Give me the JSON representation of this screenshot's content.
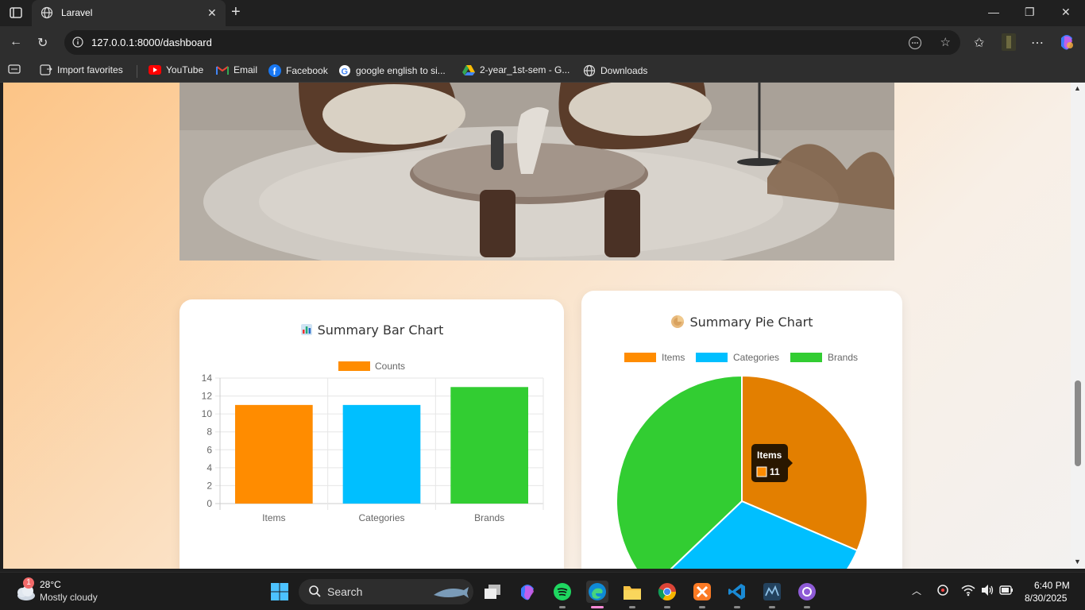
{
  "browser": {
    "tab_title": "Laravel",
    "url": "127.0.0.1:8000/dashboard"
  },
  "favorites": [
    {
      "label": "Import favorites",
      "icon": "import-icon"
    },
    {
      "label": "YouTube",
      "icon": "youtube-icon"
    },
    {
      "label": "Email",
      "icon": "gmail-icon"
    },
    {
      "label": "Facebook",
      "icon": "facebook-icon"
    },
    {
      "label": "google english to si...",
      "icon": "google-icon"
    },
    {
      "label": "2-year_1st-sem - G...",
      "icon": "google-drive-icon"
    },
    {
      "label": "Downloads",
      "icon": "globe-icon"
    }
  ],
  "page": {
    "bar_card_title": "Summary Bar Chart",
    "pie_card_title": "Summary Pie Chart"
  },
  "colors": {
    "items": "#ff8c00",
    "categories": "#00bfff",
    "brands": "#32cd32"
  },
  "chart_data": [
    {
      "type": "bar",
      "title": "Summary Bar Chart",
      "categories": [
        "Items",
        "Categories",
        "Brands"
      ],
      "series": [
        {
          "name": "Counts",
          "values": [
            11,
            11,
            13
          ]
        }
      ],
      "yticks": [
        "14",
        "12",
        "10",
        "8",
        "6",
        "4",
        "2",
        "0"
      ],
      "ylim": [
        0,
        14
      ],
      "grid": true,
      "legend": "top"
    },
    {
      "type": "pie",
      "title": "Summary Pie Chart",
      "labels": [
        "Items",
        "Categories",
        "Brands"
      ],
      "values": [
        11,
        11,
        13
      ],
      "legend": "top",
      "tooltip": {
        "label": "Items",
        "value": "11"
      }
    }
  ],
  "taskbar": {
    "weather_temp": "28°C",
    "weather_desc": "Mostly cloudy",
    "weather_badge": "1",
    "search_label": "Search",
    "time": "6:40 PM",
    "date": "8/30/2025"
  }
}
